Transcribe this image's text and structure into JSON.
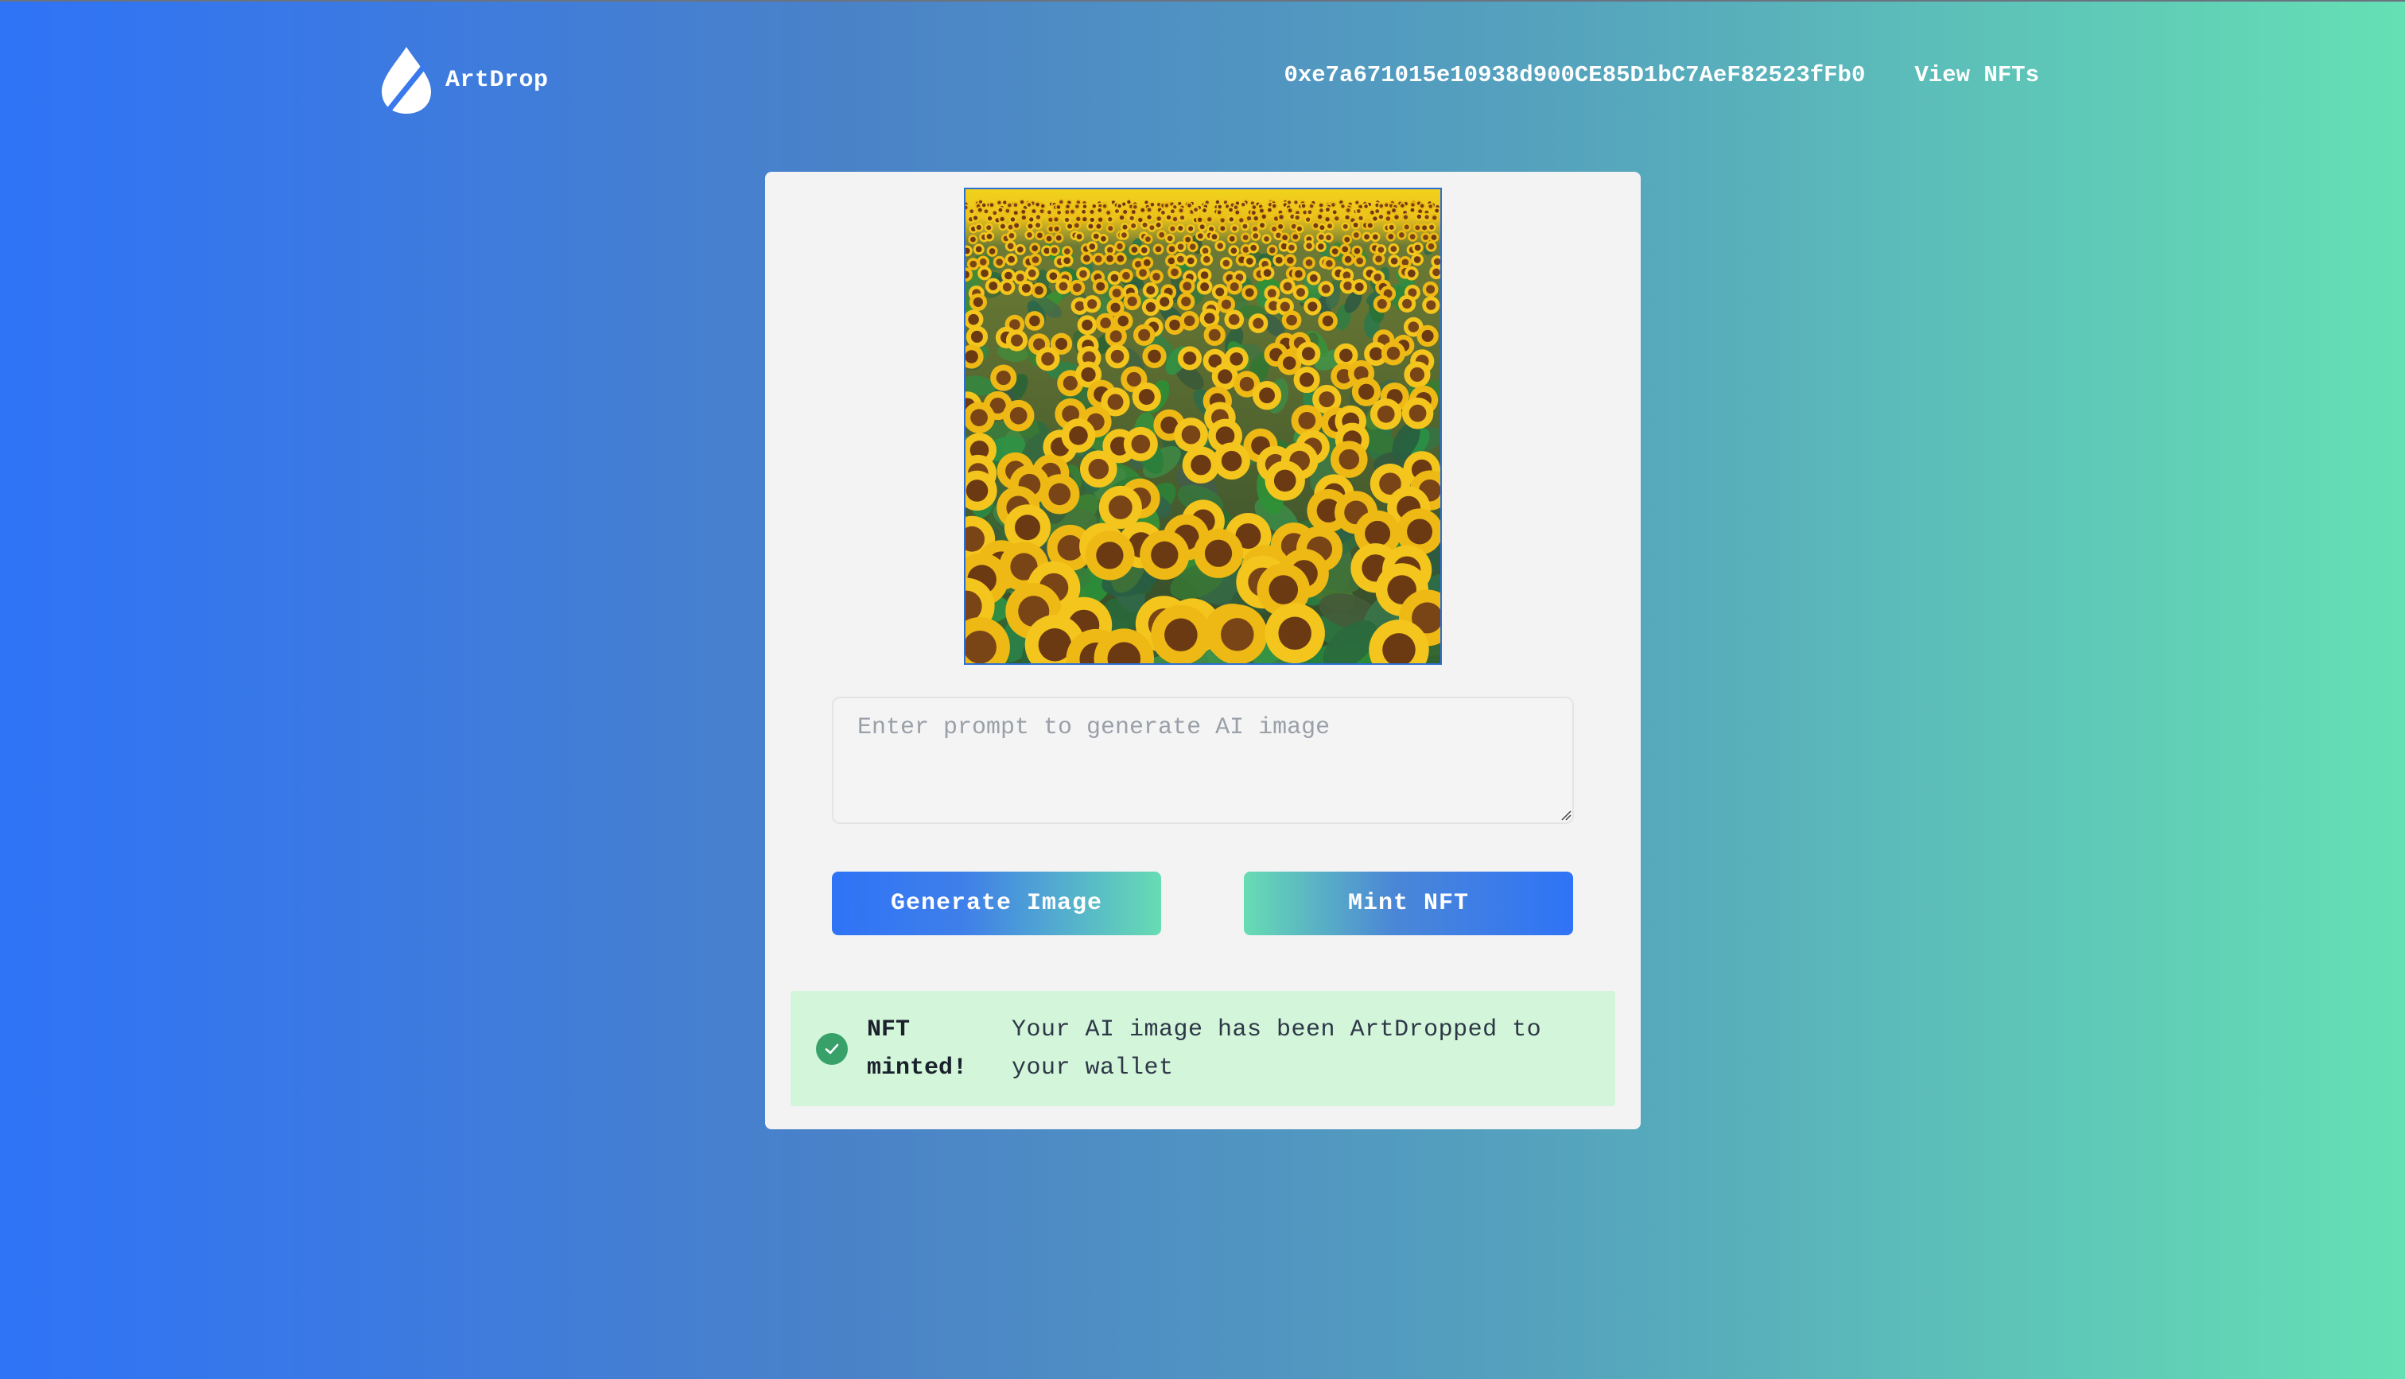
{
  "header": {
    "brand_name": "ArtDrop",
    "wallet_address": "0xe7a671015e10938d900CE85D1bC7AeF82523fFb0",
    "view_nfts_label": "View NFTs"
  },
  "main": {
    "image_icon": "sunflower-field-image",
    "prompt_placeholder": "Enter prompt to generate AI image",
    "prompt_value": "",
    "generate_label": "Generate Image",
    "mint_label": "Mint NFT"
  },
  "alert": {
    "icon": "check-circle-icon",
    "title": "NFT minted!",
    "description": "Your AI image has been ArtDropped to your wallet"
  },
  "colors": {
    "gradient_start": "#2f73f7",
    "gradient_end": "#65e0b4",
    "card_bg": "#f3f3f3",
    "alert_bg": "#d3f5d9",
    "success_green": "#38a169"
  }
}
